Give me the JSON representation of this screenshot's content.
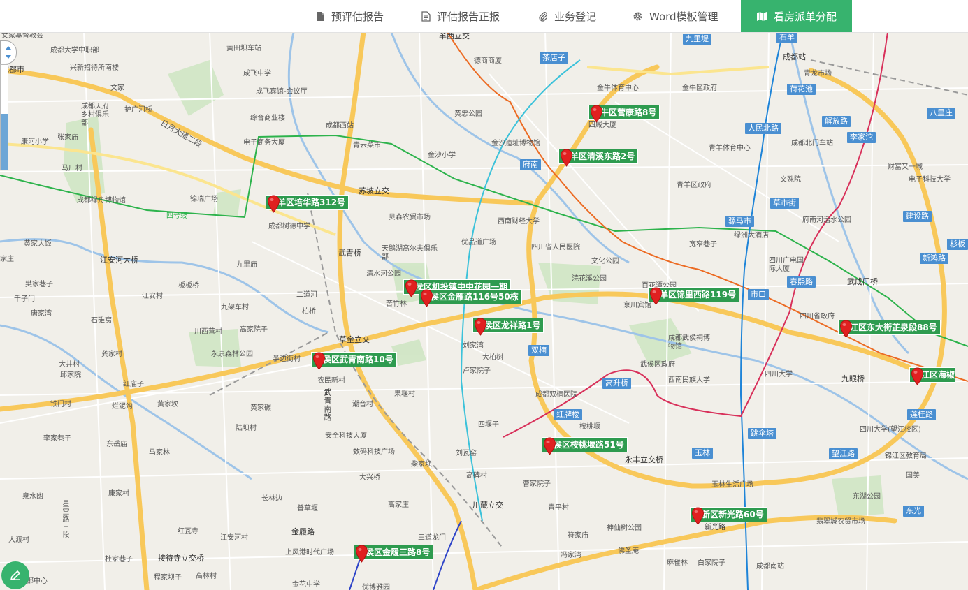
{
  "nav": {
    "tabs": [
      {
        "label": "预评估报告",
        "icon": "file-icon"
      },
      {
        "label": "评估报告正报",
        "icon": "file-text-icon"
      },
      {
        "label": "业务登记",
        "icon": "paperclip-icon"
      },
      {
        "label": "Word模板管理",
        "icon": "gear-icon"
      },
      {
        "label": "看房派单分配",
        "icon": "map-icon",
        "active": true
      }
    ]
  },
  "markers": [
    "金牛区营康路8号",
    "青羊区清溪东路2号",
    "青羊区培华路312号",
    "武侯区机投镇中中花园一期",
    "武侯区金雁路116号50栋",
    "青羊区锦里西路119号",
    "武侯区龙祥路1号",
    "锦江区东大街芷泉段88号",
    "武侯区武青南路10号",
    "锦江区海椒",
    "武侯区桉桃堰路51号",
    "高新区新光路60号",
    "武侯区金履三路8号"
  ],
  "metro_stations": [
    "茶店子",
    "府南",
    "人民北路",
    "荷花池",
    "解放路",
    "李家沱",
    "八里庄",
    "草市街",
    "骡马市",
    "建设路",
    "新鸿路",
    "春熙路",
    "杉板",
    "双楠",
    "高升桥",
    "红牌楼",
    "跳伞塔",
    "玉林",
    "望江路",
    "莲桂路",
    "东光",
    "九里堤",
    "石羊",
    "市口"
  ],
  "map_labels": {
    "a": [
      "文家基督教会",
      "成都大学中职部",
      "成都市",
      "兴新招待所南楼",
      "文家",
      "成都天府乡村俱乐部",
      "护广河桥",
      "张家庙",
      "康河小学",
      "马厂村",
      "成都绿舟博物馆",
      "锦瑞广场",
      "四号线",
      "成都树德中学",
      "黄家大饭",
      "家庄",
      "江安河大桥",
      "樊家巷子",
      "千子门",
      "唐家湾",
      "石碓窝",
      "江安村",
      "板板桥",
      "九里庙",
      "九架车村",
      "二道河",
      "柏桥",
      "川西营村",
      "高家院子",
      "半边街村",
      "永康森林公园",
      "龚家村",
      "大井村",
      "邱家院",
      "红庙子",
      "铁门村",
      "烂泥沟",
      "黄家坎",
      "李家巷子",
      "东岳庙",
      "陆坝村",
      "黄家碾",
      "马家林",
      "泉水凼",
      "康家村",
      "长林边",
      "普草堰",
      "星空路三段",
      "大渡村",
      "红瓦寺",
      "江安河村",
      "杜家巷子",
      "上风港时代广场",
      "金履路",
      "接待寺立交桥",
      "程家坝子",
      "高林村",
      "金花中学",
      "优博雅园",
      "成都中心"
    ],
    "b": [
      "黄田坝车站",
      "成飞宾馆-会议厅",
      "成飞中学",
      "综合商业楼",
      "电子商务大厦",
      "成都西站",
      "日月大道二段",
      "青云菜市",
      "金沙小学",
      "金沙遗址博物馆",
      "黄忠公园",
      "德商商厦",
      "羊西立交",
      "苏坡立交",
      "贝森农贸市场",
      "西南财经大学",
      "武青桥",
      "天鹅湖高尔夫俱乐部",
      "清水河公园",
      "优品道广场",
      "苦竹林",
      "四川省人民医院",
      "文化公园",
      "浣花溪公园",
      "京川宾馆",
      "刘家湾",
      "大柏树",
      "卢家院子",
      "草金立交",
      "武青南路",
      "农民新村",
      "潮音村",
      "果堰村",
      "安全科技大厦",
      "数码科技广场",
      "柴家坝",
      "刘瓦窑",
      "大兴桥",
      "四堰子",
      "高碑村",
      "桉桃堰",
      "成都双楠医院",
      "武侯区政府",
      "西南民族大学",
      "成都武侯祠博物馆",
      "四川大学",
      "永丰立交桥",
      "青平村",
      "曹家院子",
      "高家庄",
      "川藏立交",
      "三道龙门",
      "神仙树公园",
      "符家庙",
      "冯家湾",
      "佛圣庵",
      "麻雀林",
      "白家院子",
      "新光路",
      "玉林生活广场"
    ],
    "c": [
      "金牛体育中心",
      "金牛区政府",
      "成都站",
      "青龙市场",
      "四威大厦",
      "成都北门车站",
      "青羊体育中心",
      "财富又一城",
      "文殊院",
      "青羊区政府",
      "电子科技大学",
      "府南河活水公园",
      "宽窄巷子",
      "绿洲大酒店",
      "四川广电国际大厦",
      "百花潭公园",
      "四川省政府",
      "武成门桥",
      "九眼桥",
      "四川大学(望江校区)",
      "锦江区教育局",
      "国美",
      "东湖公园",
      "翡翠城农贸市场",
      "成都南站"
    ]
  },
  "controls": {
    "edit_icon": "pencil-icon",
    "compass_icon": "pan-control-icon"
  },
  "colors": {
    "accent": "#37b36e",
    "marker": "#e02020",
    "tag": "#2e9b4f",
    "metro": "#4a8fd1"
  }
}
